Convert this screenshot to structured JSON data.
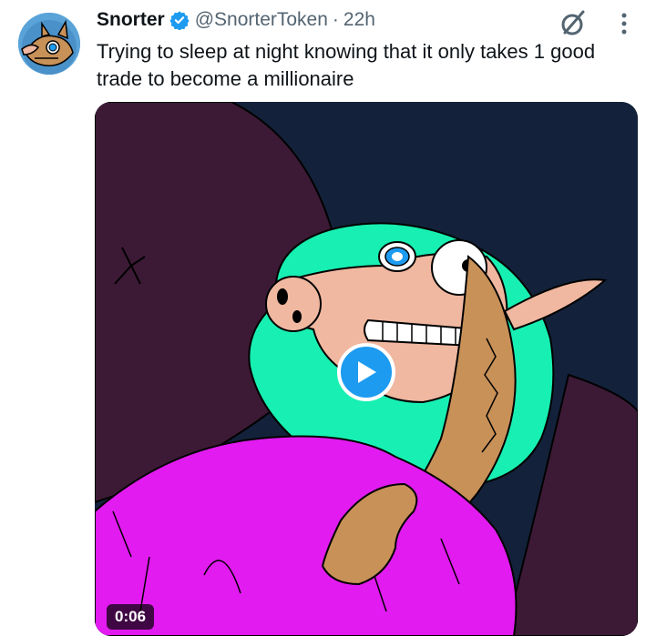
{
  "tweet": {
    "author_name": "Snorter",
    "verified_icon": "verified-badge-icon",
    "handle": "@SnorterToken",
    "separator": "·",
    "time": "22h",
    "text": "Trying to sleep at night knowing that it only takes 1 good trade to become a millionaire"
  },
  "media": {
    "type": "video",
    "duration": "0:06",
    "play_icon": "play-icon"
  },
  "icons": {
    "grok": "grok-icon",
    "more": "more-options-icon",
    "avatar": "snorter-avatar"
  },
  "colors": {
    "accent": "#1d9bf0",
    "secondary_text": "#536471",
    "primary_text": "#0f1419",
    "blanket": "#e21bf0",
    "hair": "#17f0b2",
    "night_sky": "#13223a"
  }
}
